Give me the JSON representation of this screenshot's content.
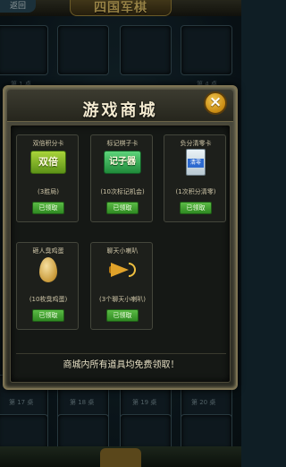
{
  "lobby": {
    "back_label": "返回",
    "logo_text": "四国军棋",
    "table_labels": [
      "第 1 桌",
      "第 4 桌",
      "第 17 桌",
      "第 18 桌",
      "第 19 桌",
      "第 20 桌"
    ]
  },
  "shop": {
    "title": "游戏商城",
    "close_label": "×",
    "claim_label": "已领取",
    "footer": "商城内所有道具均免费领取！",
    "items": [
      {
        "name": "双倍积分卡",
        "icon_text": "双倍",
        "icon": "double-card-icon",
        "desc": "(3胜局)"
      },
      {
        "name": "标记棋子卡",
        "icon_text": "记子器",
        "icon": "marker-card-icon",
        "desc": "(10次标记机会)"
      },
      {
        "name": "负分清零卡",
        "icon_text": "清零",
        "icon": "clear-card-icon",
        "desc": "(1次积分清零)"
      },
      {
        "name": "砸人臭鸡蛋",
        "icon_text": "",
        "icon": "egg-icon",
        "desc": "(10枚臭鸡蛋)"
      },
      {
        "name": "聊天小喇叭",
        "icon_text": "",
        "icon": "horn-icon",
        "desc": "(3个聊天小喇叭)"
      }
    ]
  }
}
